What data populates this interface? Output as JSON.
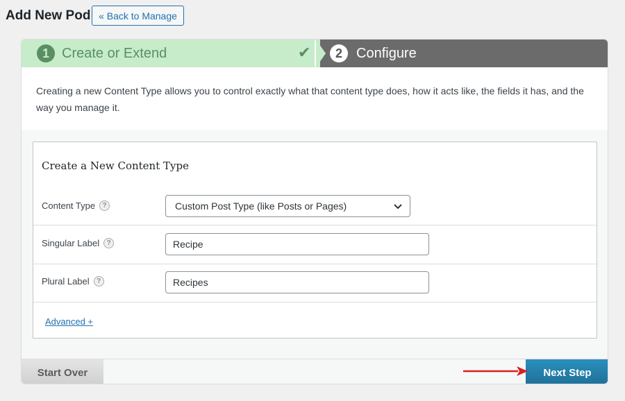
{
  "header": {
    "title": "Add New Pod",
    "back_label": "« Back to Manage"
  },
  "steps": [
    {
      "number": "1",
      "label": "Create or Extend",
      "status": "complete"
    },
    {
      "number": "2",
      "label": "Configure",
      "status": "active"
    }
  ],
  "intro_text": "Creating a new Content Type allows you to control exactly what that content type does, how it acts like, the fields it has, and the way you manage it.",
  "form": {
    "title": "Create a New Content Type",
    "content_type": {
      "label": "Content Type",
      "value": "Custom Post Type (like Posts or Pages)"
    },
    "singular_label": {
      "label": "Singular Label",
      "value": "Recipe"
    },
    "plural_label": {
      "label": "Plural Label",
      "value": "Recipes"
    },
    "help_glyph": "?",
    "advanced_link": "Advanced +"
  },
  "footer": {
    "start_over": "Start Over",
    "next_step": "Next Step"
  },
  "colors": {
    "step_complete_bg": "#c6ecca",
    "step_active_bg": "#6b6b6b",
    "primary_button": "#2b8fbd",
    "annotation_arrow": "#d9201f"
  },
  "icons": [
    "check-icon",
    "chevron-down-icon",
    "help-icon",
    "red-arrow-icon"
  ]
}
